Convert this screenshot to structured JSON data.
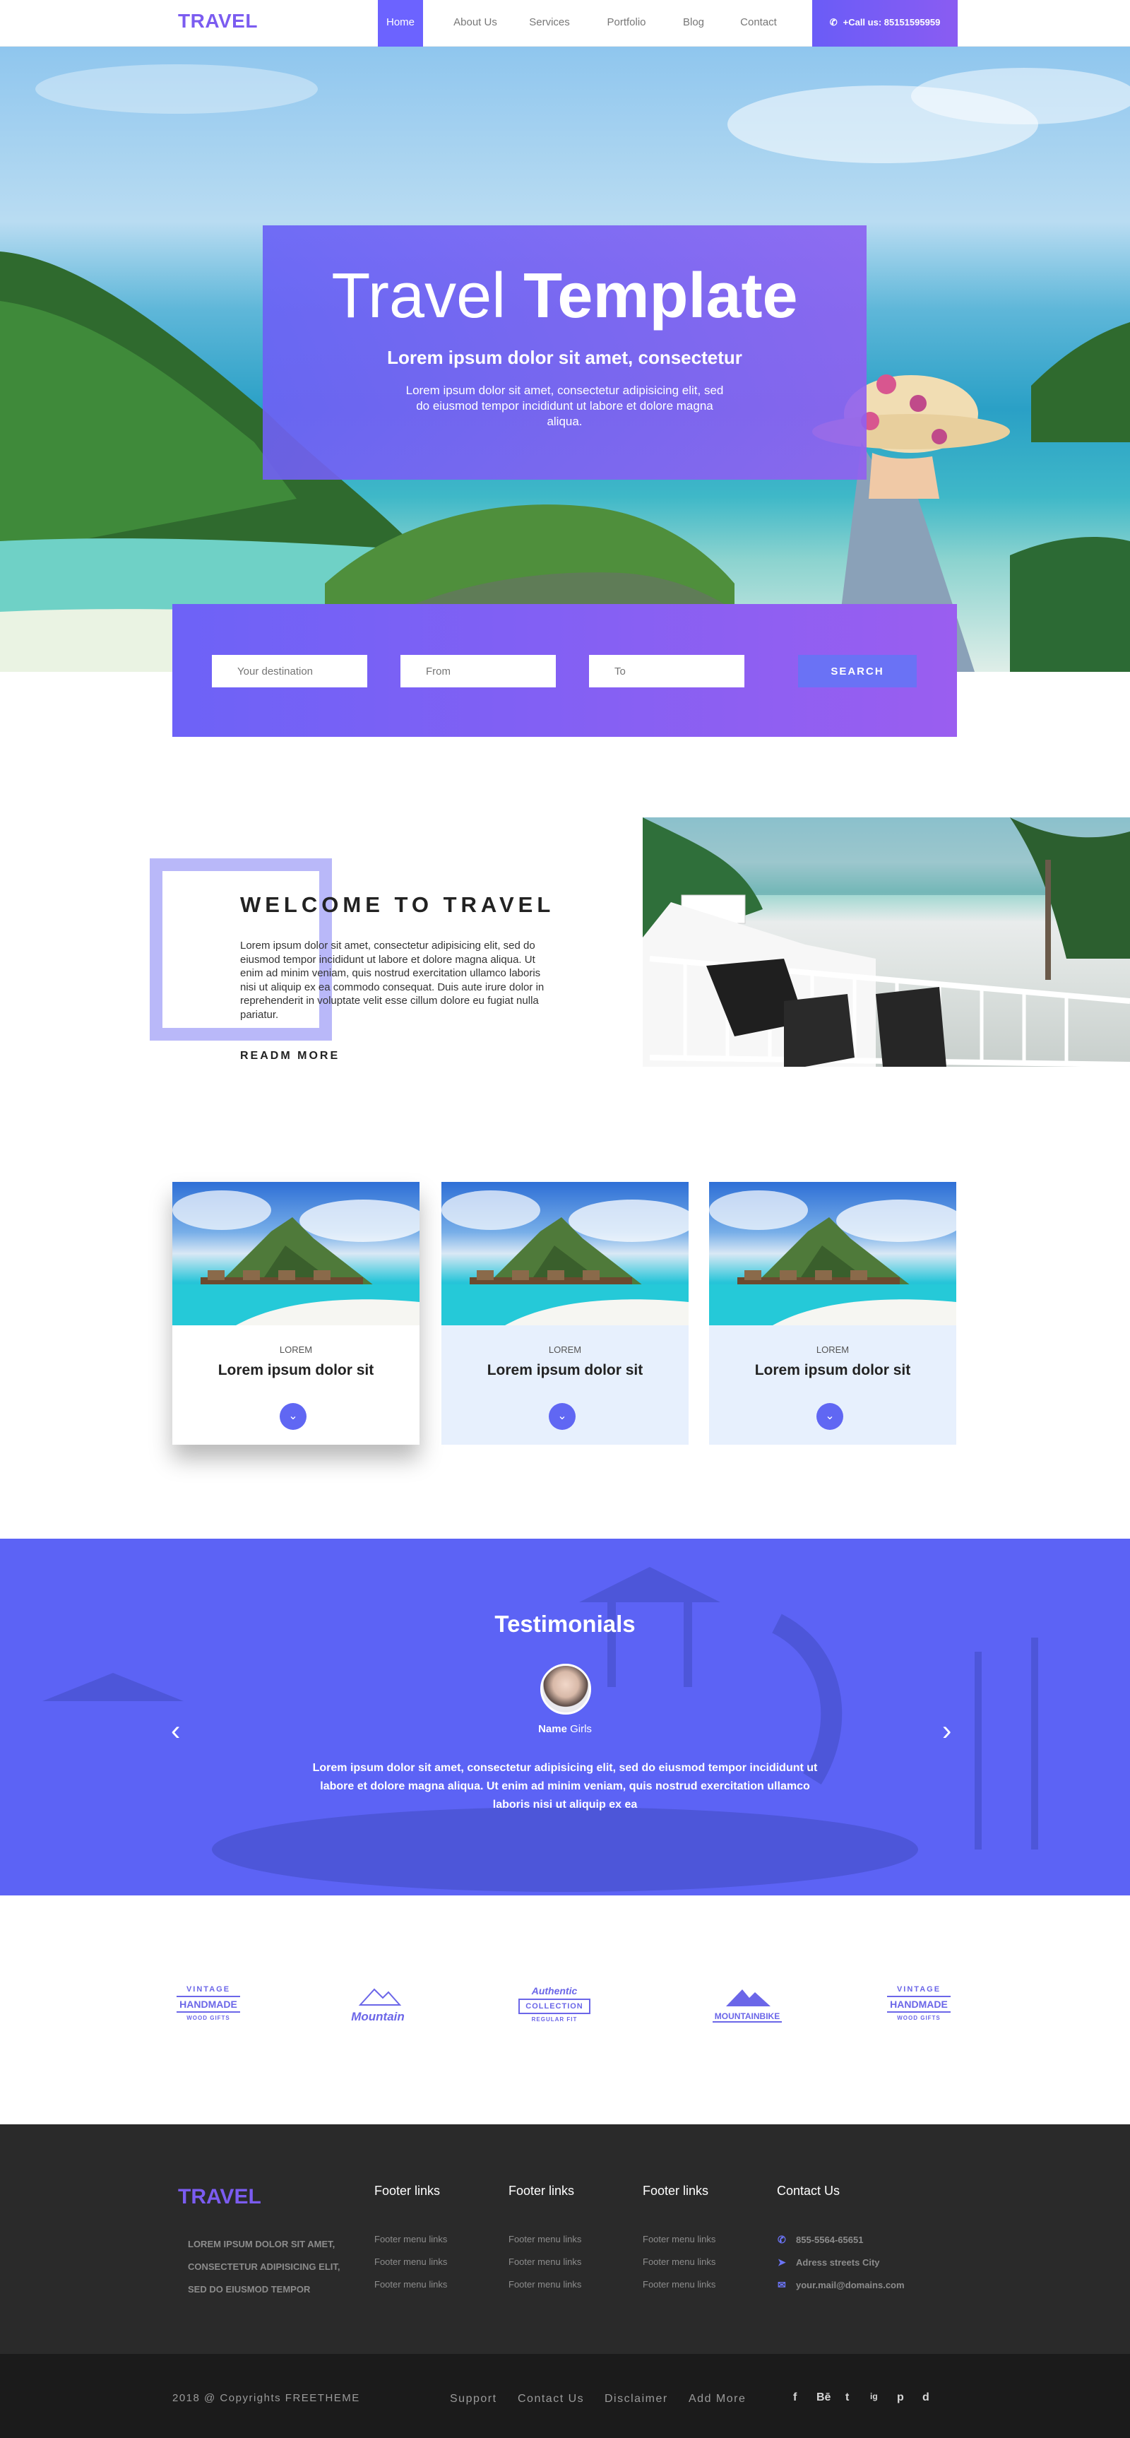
{
  "header": {
    "logo": "TRAVEL",
    "nav": [
      "Home",
      "About Us",
      "Services",
      "Portfolio",
      "Blog",
      "Contact"
    ],
    "active_nav": "Home",
    "call": "+Call us: 85151595959"
  },
  "hero": {
    "title_thin": "Travel",
    "title_bold": "Template",
    "subtitle": "Lorem ipsum dolor sit amet, consectetur",
    "description": "Lorem ipsum dolor sit amet, consectetur adipisicing elit, sed do eiusmod tempor incididunt ut labore et dolore magna aliqua."
  },
  "search": {
    "destination_placeholder": "Your destination",
    "from_placeholder": "From",
    "to_placeholder": "To",
    "button_label": "SEARCH"
  },
  "welcome": {
    "title": "WELCOME TO TRAVEL",
    "text": "Lorem ipsum dolor sit amet, consectetur adipisicing elit, sed do eiusmod tempor incididunt ut labore et dolore magna aliqua. Ut enim ad minim veniam, quis nostrud exercitation ullamco laboris nisi ut aliquip ex ea commodo consequat. Duis aute irure dolor in reprehenderit in voluptate velit esse cillum dolore eu fugiat nulla pariatur.",
    "read_more": "READM MORE"
  },
  "cards": [
    {
      "category": "LOREM",
      "title": "Lorem ipsum dolor sit"
    },
    {
      "category": "LOREM",
      "title": "Lorem ipsum dolor sit"
    },
    {
      "category": "LOREM",
      "title": "Lorem ipsum dolor sit"
    }
  ],
  "testimonials": {
    "title": "Testimonials",
    "name": "Name",
    "role": "Girls",
    "text": "Lorem ipsum dolor sit amet, consectetur adipisicing elit, sed do eiusmod tempor incididunt ut labore et dolore magna aliqua. Ut enim ad minim veniam, quis nostrud exercitation ullamco laboris nisi ut aliquip ex ea"
  },
  "brand_logos": [
    {
      "top": "VINTAGE",
      "main": "HANDMADE",
      "bottom": "WOOD GIFTS"
    },
    {
      "top": "",
      "main": "Mountain",
      "bottom": ""
    },
    {
      "top": "Authentic",
      "main": "COLLECTION",
      "bottom": "REGULAR FIT"
    },
    {
      "top": "",
      "main": "MOUNTAINBIKE",
      "bottom": ""
    },
    {
      "top": "VINTAGE",
      "main": "HANDMADE",
      "bottom": "WOOD GIFTS"
    }
  ],
  "footer": {
    "logo": "TRAVEL",
    "tagline": "LOREM IPSUM DOLOR SIT AMET, CONSECTETUR ADIPISICING ELIT, SED DO EIUSMOD TEMPOR",
    "columns": [
      {
        "heading": "Footer links",
        "links": [
          "Footer menu links",
          "Footer menu links",
          "Footer menu links"
        ]
      },
      {
        "heading": "Footer links",
        "links": [
          "Footer menu links",
          "Footer menu links",
          "Footer menu links"
        ]
      },
      {
        "heading": "Footer links",
        "links": [
          "Footer menu links",
          "Footer menu links",
          "Footer menu links"
        ]
      }
    ],
    "contact": {
      "heading": "Contact Us",
      "phone": "855-5564-65651",
      "address": "Adress streets City",
      "email": "your.mail@domains.com"
    }
  },
  "bottom_bar": {
    "copyright": "2018 @ Copyrights FREETHEME",
    "links": [
      "Support",
      "Contact Us",
      "Disclaimer",
      "Add More"
    ],
    "social": [
      "f",
      "Bē",
      "t",
      "ig",
      "p",
      "d"
    ]
  },
  "colors": {
    "primary": "#6c63ff",
    "accent": "#7b5cf0",
    "footer": "#2a2a2a",
    "bottom": "#1b1b1b"
  }
}
